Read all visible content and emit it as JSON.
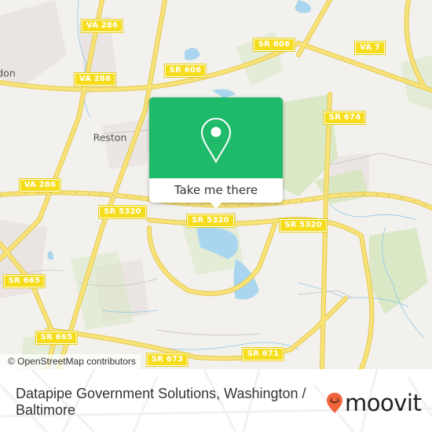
{
  "map": {
    "place_labels": [
      {
        "id": "reston",
        "text": "Reston"
      },
      {
        "id": "herndon-partial",
        "text": "don"
      }
    ],
    "road_shields": [
      {
        "id": "va286-top",
        "text": "VA 286"
      },
      {
        "id": "va286-mid",
        "text": "VA 286"
      },
      {
        "id": "va286-left",
        "text": "VA 286"
      },
      {
        "id": "sr606-left",
        "text": "SR 606"
      },
      {
        "id": "sr606-right",
        "text": "SR 606"
      },
      {
        "id": "va7",
        "text": "VA 7"
      },
      {
        "id": "sr674",
        "text": "SR 674"
      },
      {
        "id": "sr5320-left",
        "text": "SR 5320"
      },
      {
        "id": "sr5320-center",
        "text": "SR 5320"
      },
      {
        "id": "sr5320-right",
        "text": "SR 5320"
      },
      {
        "id": "sr665-top",
        "text": "SR 665"
      },
      {
        "id": "sr665-bottom",
        "text": "SR 665"
      },
      {
        "id": "sr673",
        "text": "SR 673"
      },
      {
        "id": "sr671",
        "text": "SR 671"
      }
    ],
    "colors": {
      "background": "#f2f1ee",
      "road": "#f7e26b",
      "road_outline": "#e6c94a",
      "water": "#a6d5ec",
      "park": "#d7e8c0",
      "residential": "#e8e0df"
    },
    "attribution": "© OpenStreetMap contributors"
  },
  "popup": {
    "icon": "map-pin-icon",
    "action_label": "Take me there",
    "color": "#1fba6a"
  },
  "footer": {
    "place_title": "Datapipe Government Solutions, Washington / Baltimore",
    "brand_name": "moovit",
    "brand_color": "#f0643c"
  }
}
